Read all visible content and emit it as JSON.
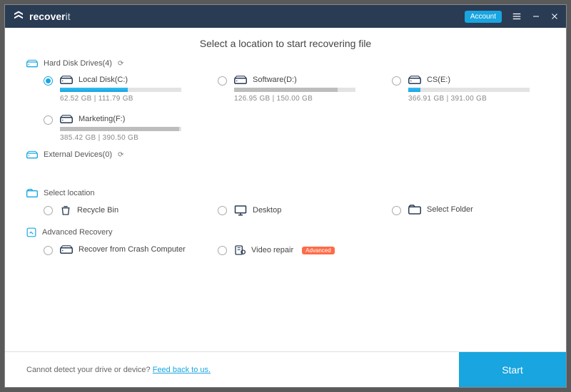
{
  "titlebar": {
    "brand_bold": "recover",
    "brand_thin": "it",
    "account_label": "Account"
  },
  "heading": "Select a location to start recovering file",
  "sections": {
    "hard_disk": {
      "title": "Hard Disk Drives(4)",
      "drives": [
        {
          "label": "Local Disk(C:)",
          "used": "62.52  GB",
          "total": "111.79  GB",
          "fill_pct": 56,
          "selected": true,
          "fill_color": "blue"
        },
        {
          "label": "Software(D:)",
          "used": "126.95  GB",
          "total": "150.00  GB",
          "fill_pct": 85,
          "selected": false,
          "fill_color": "gray"
        },
        {
          "label": "CS(E:)",
          "used": "366.91  GB",
          "total": "391.00  GB",
          "fill_pct": 10,
          "selected": false,
          "fill_color": "blue"
        },
        {
          "label": "Marketing(F:)",
          "used": "385.42  GB",
          "total": "390.50  GB",
          "fill_pct": 98,
          "selected": false,
          "fill_color": "gray"
        }
      ]
    },
    "external": {
      "title": "External Devices(0)"
    },
    "select_location": {
      "title": "Select location",
      "items": [
        {
          "label": "Recycle Bin",
          "icon": "recycle-bin-icon"
        },
        {
          "label": "Desktop",
          "icon": "desktop-icon"
        },
        {
          "label": "Select Folder",
          "icon": "folder-icon"
        }
      ]
    },
    "advanced": {
      "title": "Advanced Recovery",
      "items": [
        {
          "label": "Recover from Crash Computer",
          "icon": "crash-computer-icon",
          "badge": null
        },
        {
          "label": "Video repair",
          "icon": "video-repair-icon",
          "badge": "Advanced"
        }
      ]
    }
  },
  "footer": {
    "text": "Cannot detect your drive or device? ",
    "link": "Feed back to us.",
    "start_label": "Start"
  }
}
